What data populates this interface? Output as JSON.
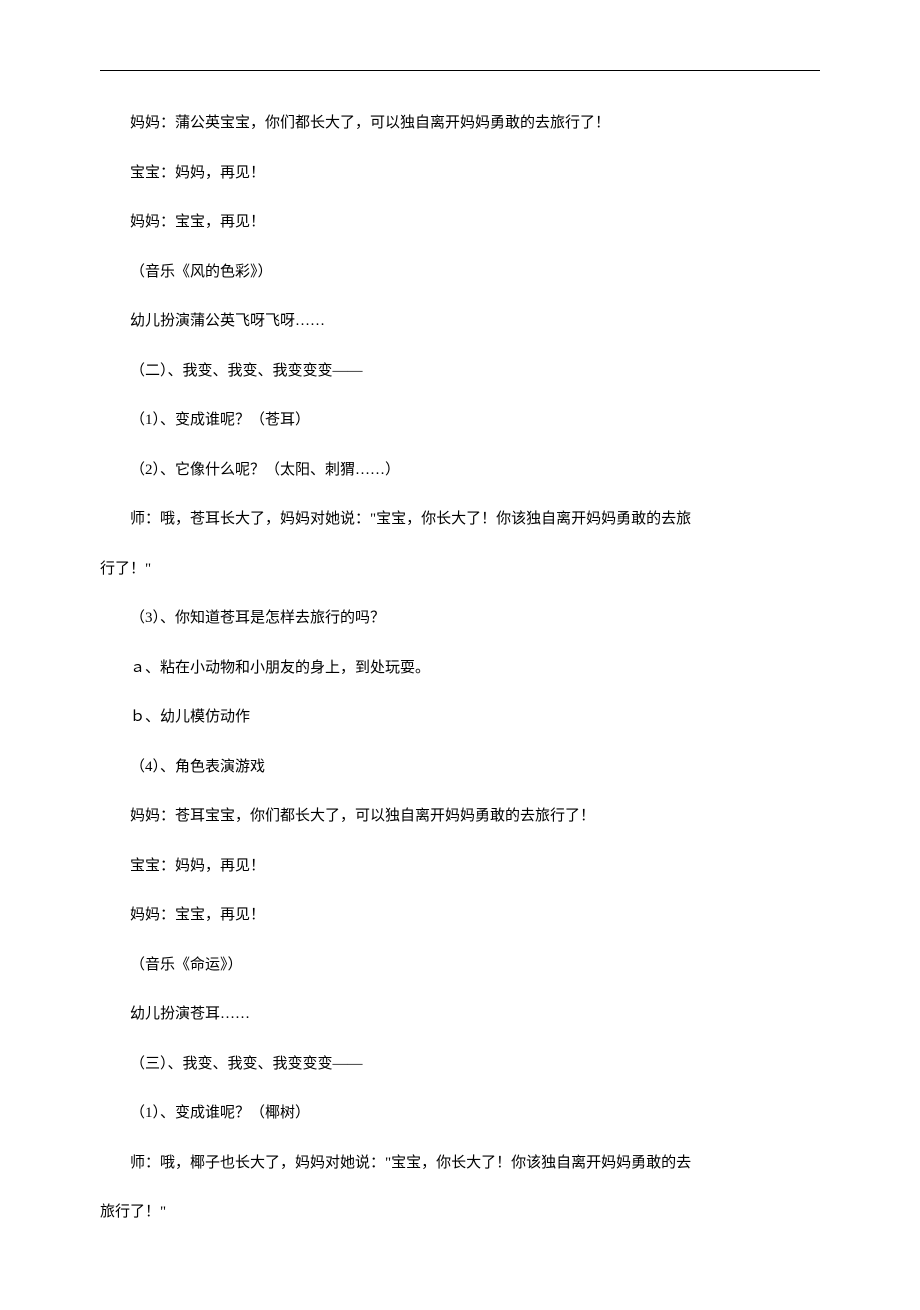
{
  "paragraphs": [
    {
      "text": "妈妈：蒲公英宝宝，你们都长大了，可以独自离开妈妈勇敢的去旅行了！",
      "indent": true
    },
    {
      "text": "宝宝：妈妈，再见！",
      "indent": true
    },
    {
      "text": "妈妈：宝宝，再见！",
      "indent": true
    },
    {
      "text": "（音乐《风的色彩》）",
      "indent": true
    },
    {
      "text": "幼儿扮演蒲公英飞呀飞呀……",
      "indent": true
    },
    {
      "text": "（二）、我变、我变、我变变变——",
      "indent": true
    },
    {
      "text": "（1）、变成谁呢？（苍耳）",
      "indent": true
    },
    {
      "text": "（2）、它像什么呢？（太阳、刺猬……）",
      "indent": true
    },
    {
      "text": "师：哦，苍耳长大了，妈妈对她说：\"宝宝，你长大了！你该独自离开妈妈勇敢的去旅",
      "indent": true
    },
    {
      "text": "行了！\"",
      "indent": false
    },
    {
      "text": "（3）、你知道苍耳是怎样去旅行的吗？",
      "indent": true
    },
    {
      "text": "ａ、粘在小动物和小朋友的身上，到处玩耍。",
      "indent": true
    },
    {
      "text": "ｂ、幼儿模仿动作",
      "indent": true
    },
    {
      "text": "（4）、角色表演游戏",
      "indent": true
    },
    {
      "text": "妈妈：苍耳宝宝，你们都长大了，可以独自离开妈妈勇敢的去旅行了！",
      "indent": true
    },
    {
      "text": "宝宝：妈妈，再见！",
      "indent": true
    },
    {
      "text": "妈妈：宝宝，再见！",
      "indent": true
    },
    {
      "text": "（音乐《命运》）",
      "indent": true
    },
    {
      "text": "幼儿扮演苍耳……",
      "indent": true
    },
    {
      "text": "（三）、我变、我变、我变变变——",
      "indent": true
    },
    {
      "text": "（1）、变成谁呢？（椰树）",
      "indent": true
    },
    {
      "text": "师：哦，椰子也长大了，妈妈对她说：\"宝宝，你长大了！你该独自离开妈妈勇敢的去",
      "indent": true
    },
    {
      "text": "旅行了！\"",
      "indent": false
    }
  ]
}
